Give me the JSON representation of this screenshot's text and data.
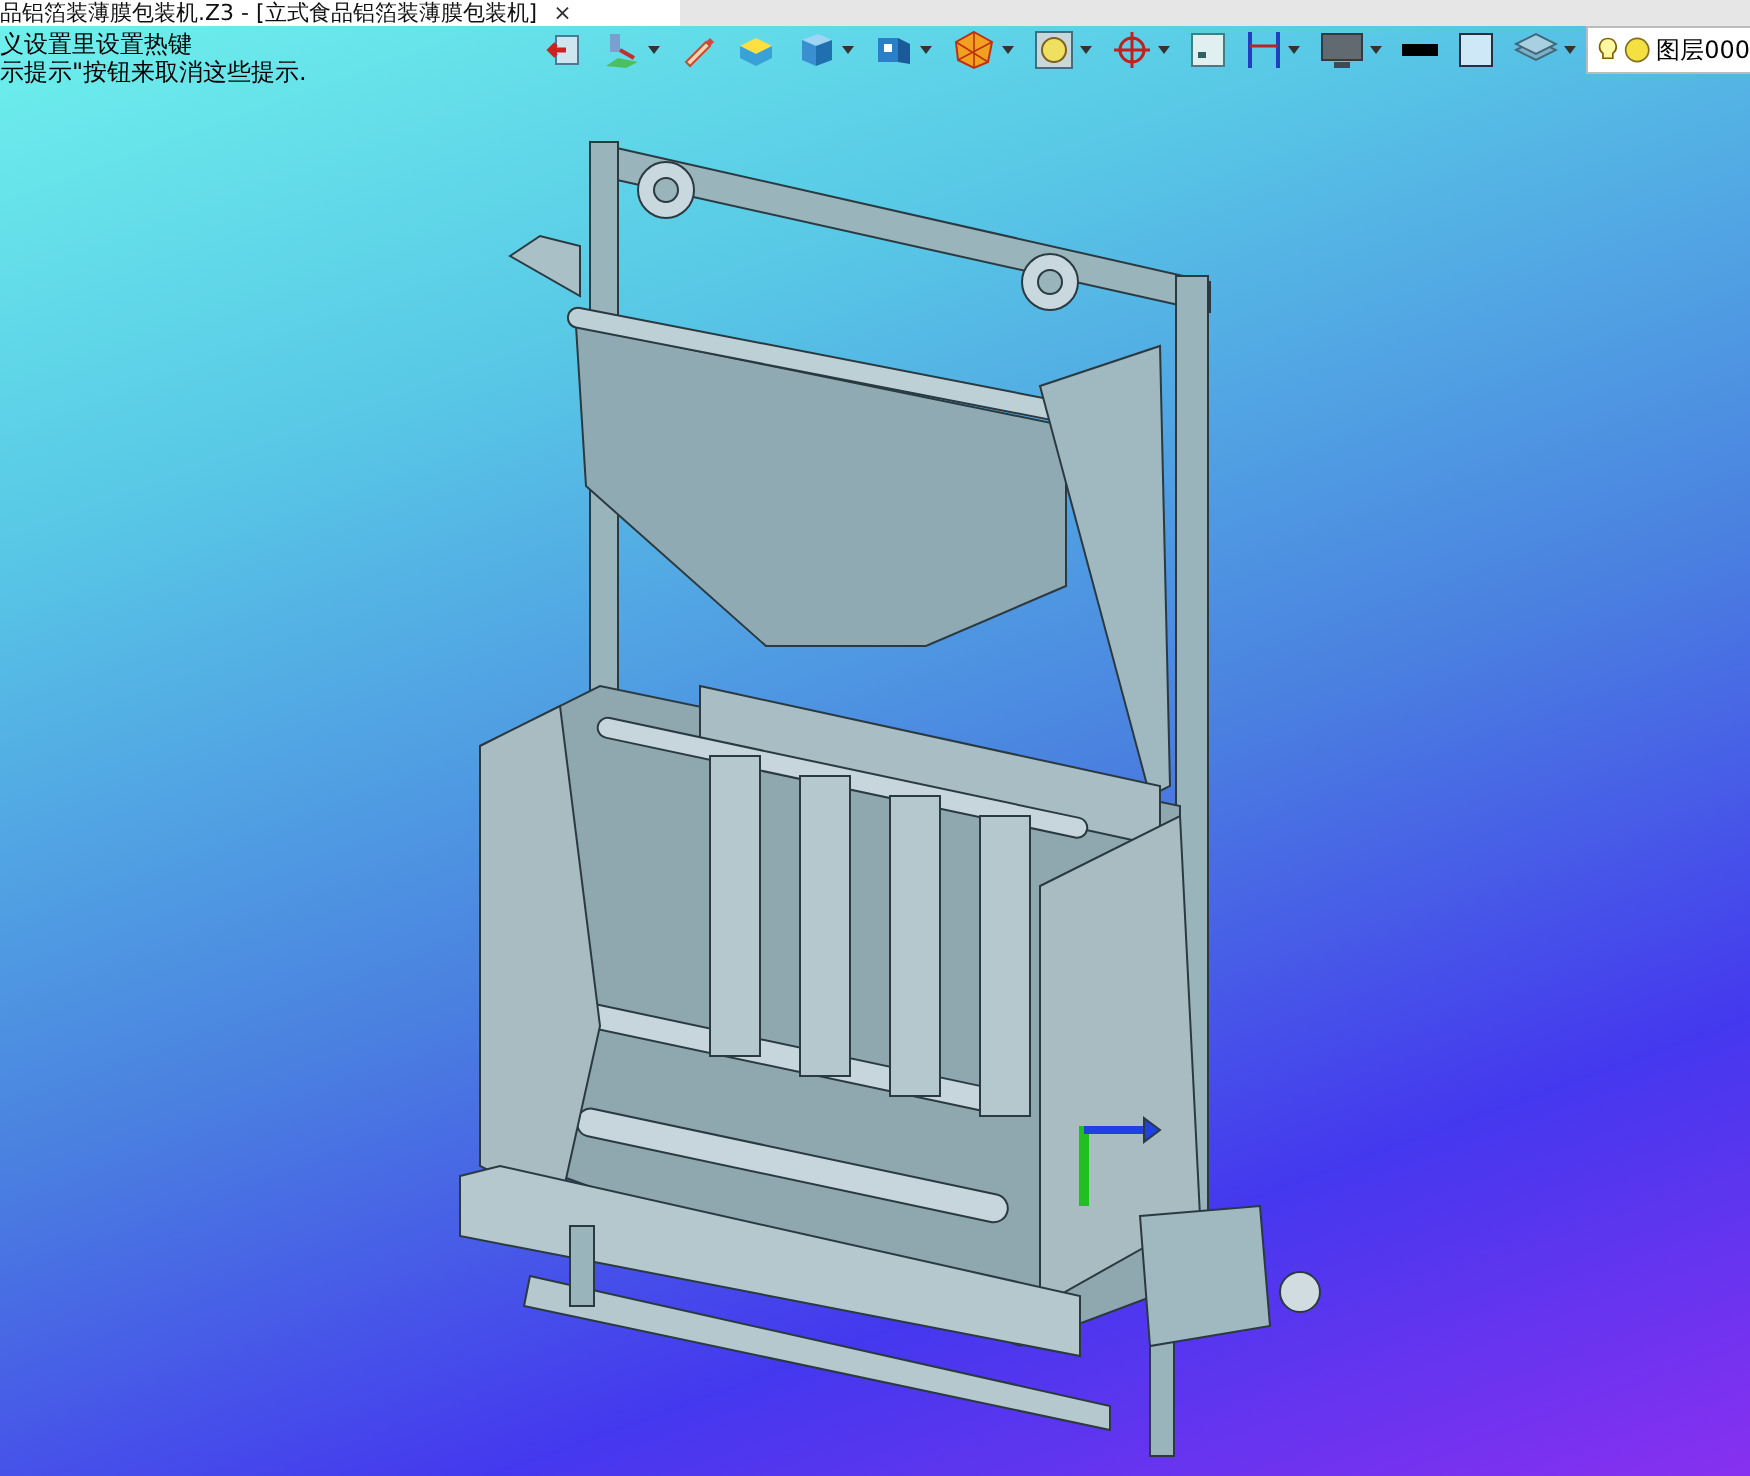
{
  "document_tab": {
    "title": "品铝箔装薄膜包装机.Z3 - [立式食品铝箔装薄膜包装机]",
    "close": "×",
    "selected": true
  },
  "hints": [
    "义设置里设置热键",
    "示提示\"按钮来取消这些提示."
  ],
  "toolbar": [
    {
      "kind": "exit",
      "dropdown": false
    },
    {
      "kind": "sketch",
      "dropdown": true
    },
    {
      "kind": "pencil",
      "dropdown": false
    },
    {
      "kind": "plane",
      "dropdown": false
    },
    {
      "kind": "cube",
      "dropdown": true
    },
    {
      "kind": "view",
      "dropdown": true
    },
    {
      "kind": "sphere",
      "dropdown": true
    },
    {
      "kind": "zoom",
      "dropdown": true
    },
    {
      "kind": "target",
      "dropdown": true
    },
    {
      "kind": "frame",
      "dropdown": false
    },
    {
      "kind": "dimension",
      "dropdown": true
    },
    {
      "kind": "monitor",
      "dropdown": true
    },
    {
      "kind": "line",
      "dropdown": false
    },
    {
      "kind": "square",
      "dropdown": false
    },
    {
      "kind": "layers",
      "dropdown": true
    }
  ],
  "layer": {
    "name": "图层000",
    "visible": true
  }
}
